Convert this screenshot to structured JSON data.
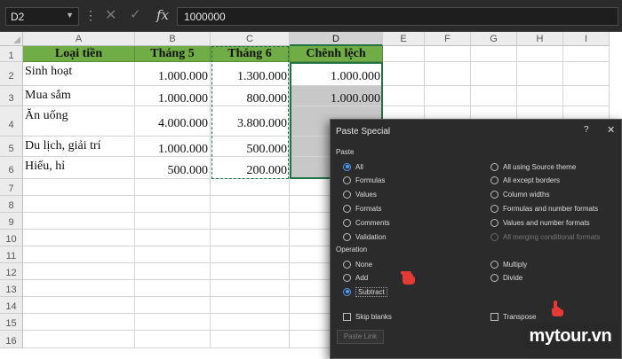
{
  "formula_bar": {
    "name_box": "D2",
    "fx_label": "fx",
    "formula": "1000000",
    "icons": {
      "cancel": "close-icon",
      "enter": "checkmark-icon",
      "more": "vertical-dots-icon"
    }
  },
  "sheet": {
    "columns": [
      "A",
      "B",
      "C",
      "D",
      "E",
      "F",
      "G",
      "H",
      "I"
    ],
    "selected_column": "D",
    "rows": [
      "1",
      "2",
      "3",
      "4",
      "5",
      "6",
      "7",
      "8",
      "9",
      "10",
      "11",
      "12",
      "13",
      "14",
      "15",
      "16"
    ],
    "headers": [
      "Loại tiền",
      "Tháng 5",
      "Tháng 6",
      "Chênh lệch"
    ],
    "data": [
      [
        "Sinh hoạt",
        "1.000.000",
        "1.300.000",
        "1.000.000"
      ],
      [
        "Mua sắm",
        "1.000.000",
        "800.000",
        "1.000.000"
      ],
      [
        "Ăn uống",
        "4.000.000",
        "3.800.000",
        ""
      ],
      [
        "Du lịch, giải trí",
        "1.000.000",
        "500.000",
        ""
      ],
      [
        "Hiếu, hỉ",
        "500.000",
        "200.000",
        ""
      ]
    ],
    "colors": {
      "header_fill": "#70ad47",
      "selection": "#217346",
      "pending_fill": "#c8c8c8"
    }
  },
  "dialog": {
    "title": "Paste Special",
    "help": "?",
    "close": "✕",
    "paste_section": "Paste",
    "paste_options_left": [
      {
        "label": "All",
        "selected": true
      },
      {
        "label": "Formulas",
        "selected": false
      },
      {
        "label": "Values",
        "selected": false
      },
      {
        "label": "Formats",
        "selected": false
      },
      {
        "label": "Comments",
        "selected": false
      },
      {
        "label": "Validation",
        "selected": false
      }
    ],
    "paste_options_right": [
      {
        "label": "All using Source theme",
        "disabled": false
      },
      {
        "label": "All except borders",
        "disabled": false
      },
      {
        "label": "Column widths",
        "disabled": false
      },
      {
        "label": "Formulas and number formats",
        "disabled": false
      },
      {
        "label": "Values and number formats",
        "disabled": false
      },
      {
        "label": "All merging conditional formats",
        "disabled": true
      }
    ],
    "operation_section": "Operation",
    "operation_left": [
      {
        "label": "None",
        "selected": false
      },
      {
        "label": "Add",
        "selected": false
      },
      {
        "label": "Subtract",
        "selected": true
      }
    ],
    "operation_right": [
      {
        "label": "Multiply",
        "selected": false
      },
      {
        "label": "Divide",
        "selected": false
      }
    ],
    "skip_blanks": "Skip blanks",
    "transpose": "Transpose",
    "paste_link": "Paste Link"
  },
  "watermark": "mytour.vn",
  "pointer_icon": "hand-pointer-icon",
  "pointer_color": "#e53935"
}
